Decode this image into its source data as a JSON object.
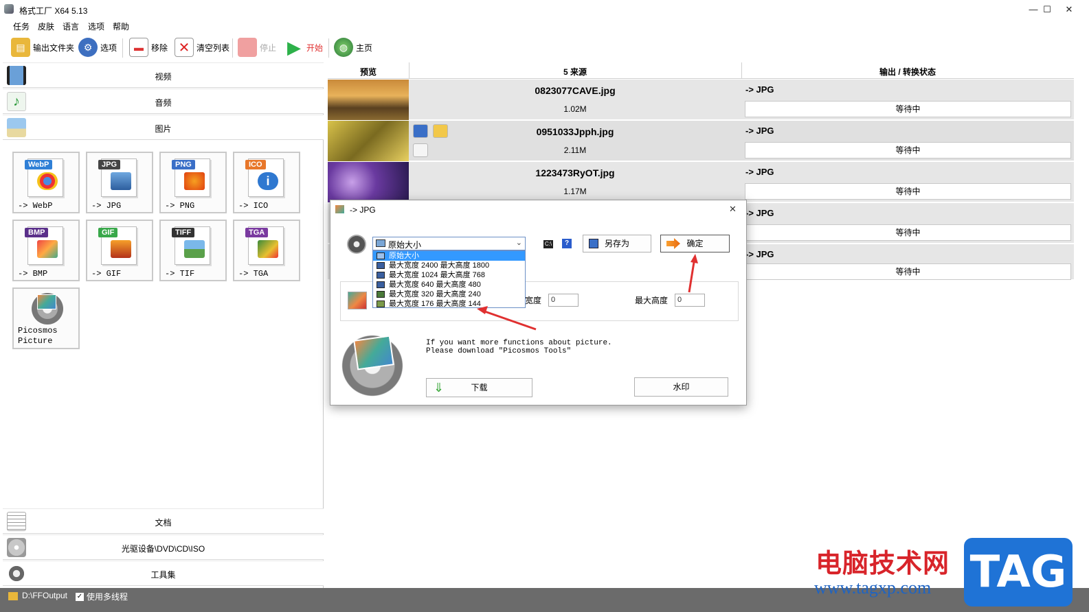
{
  "window": {
    "title": "格式工厂 X64 5.13",
    "min": "—",
    "max": "☐",
    "close": "✕"
  },
  "menu": [
    "任务",
    "皮肤",
    "语言",
    "选项",
    "帮助"
  ],
  "toolbar": {
    "output_folder": "输出文件夹",
    "options": "选项",
    "remove": "移除",
    "clear_list": "清空列表",
    "stop": "停止",
    "start": "开始",
    "home": "主页"
  },
  "categories": {
    "video": "视频",
    "audio": "音频",
    "image": "图片",
    "document": "文档",
    "optical": "光驱设备\\DVD\\CD\\ISO",
    "toolbox": "工具集"
  },
  "formats": [
    {
      "badge": "WebP",
      "label": "-> WebP",
      "badge_color": "#2f7fd6"
    },
    {
      "badge": "JPG",
      "label": "-> JPG",
      "badge_color": "#444444"
    },
    {
      "badge": "PNG",
      "label": "-> PNG",
      "badge_color": "#3a6fc7"
    },
    {
      "badge": "ICO",
      "label": "-> ICO",
      "badge_color": "#e8772a"
    },
    {
      "badge": "BMP",
      "label": "-> BMP",
      "badge_color": "#5a2f8a"
    },
    {
      "badge": "GIF",
      "label": "-> GIF",
      "badge_color": "#39a84a"
    },
    {
      "badge": "TIFF",
      "label": "-> TIF",
      "badge_color": "#333333"
    },
    {
      "badge": "TGA",
      "label": "-> TGA",
      "badge_color": "#7a3aa0"
    },
    {
      "badge": "",
      "label": "Picosmos Picture",
      "badge_color": ""
    }
  ],
  "list": {
    "col_preview": "预览",
    "col_source": "5 来源",
    "col_output": "输出 / 转换状态",
    "rows": [
      {
        "name": "0823077CAVE.jpg",
        "size": "1.02M",
        "out": "-> JPG",
        "status": "等待中"
      },
      {
        "name": "0951033Jpph.jpg",
        "size": "2.11M",
        "out": "-> JPG",
        "status": "等待中"
      },
      {
        "name": "1223473RyOT.jpg",
        "size": "1.17M",
        "out": "-> JPG",
        "status": "等待中"
      },
      {
        "name": "",
        "size": "",
        "out": "-> JPG",
        "status": "等待中"
      },
      {
        "name": "",
        "size": "",
        "out": "-> JPG",
        "status": "等待中"
      }
    ]
  },
  "dialog": {
    "title": "-> JPG",
    "selected": "原始大小",
    "options": [
      "原始大小",
      "最大宽度 2400 最大高度 1800",
      "最大宽度 1024 最大高度 768",
      "最大宽度 640 最大高度 480",
      "最大宽度 320 最大高度 240",
      "最大宽度 176 最大高度 144"
    ],
    "save_as": "另存为",
    "ok": "确定",
    "width_label": "宽度",
    "width_value": "0",
    "height_label": "最大高度",
    "height_value": "0",
    "info_line1": "If you want more functions about picture.",
    "info_line2": "Please download \"Picosmos Tools\"",
    "download": "下载",
    "watermark": "水印"
  },
  "statusbar": {
    "path": "D:\\FFOutput",
    "multithread": "使用多线程"
  },
  "watermark": {
    "brand": "电脑技术网",
    "url": "www.tagxp.com",
    "tag": "TAG"
  },
  "colors": {
    "accent_red": "#e03030",
    "start_green": "#2db14a",
    "selection_blue": "#3399ff"
  }
}
